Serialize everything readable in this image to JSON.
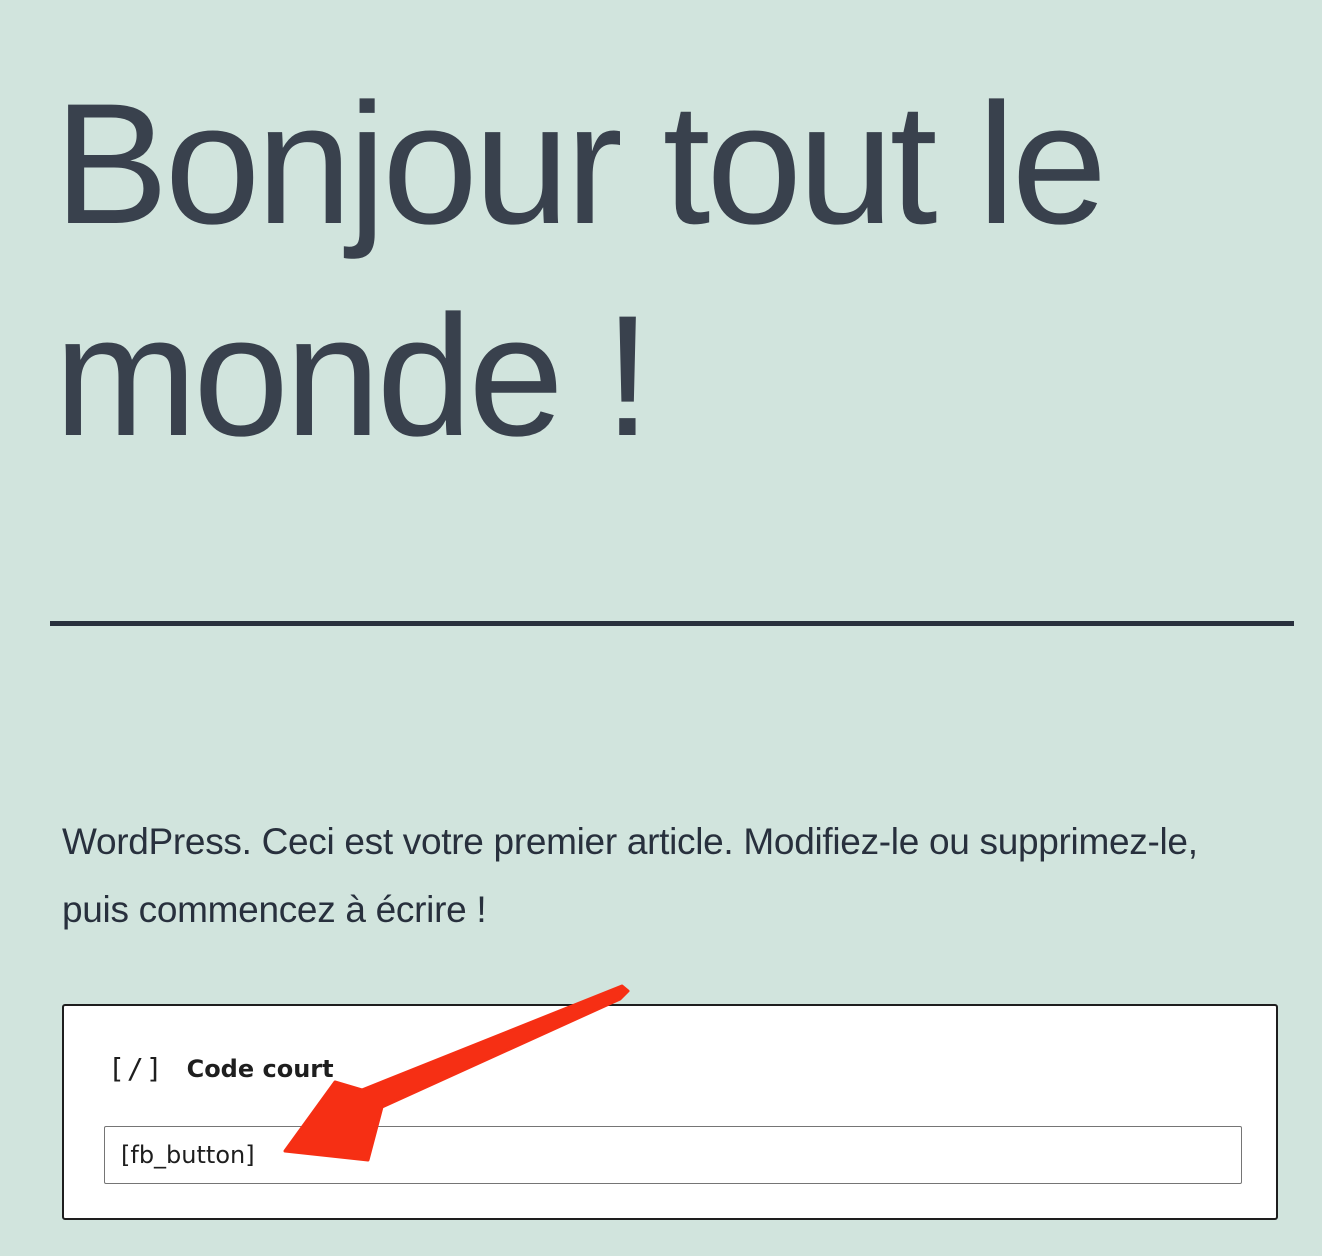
{
  "post": {
    "title": "Bonjour tout le monde !",
    "paragraph": "WordPress. Ceci est votre premier article. Modifiez-le ou supprimez-le, puis commencez à écrire !"
  },
  "shortcode_block": {
    "icon": "[/]",
    "title": "Code court",
    "value": "[fb_button]"
  },
  "annotation": {
    "arrow_color": "#f62f14"
  },
  "colors": {
    "background": "#d1e4dd",
    "text": "#28303d"
  }
}
